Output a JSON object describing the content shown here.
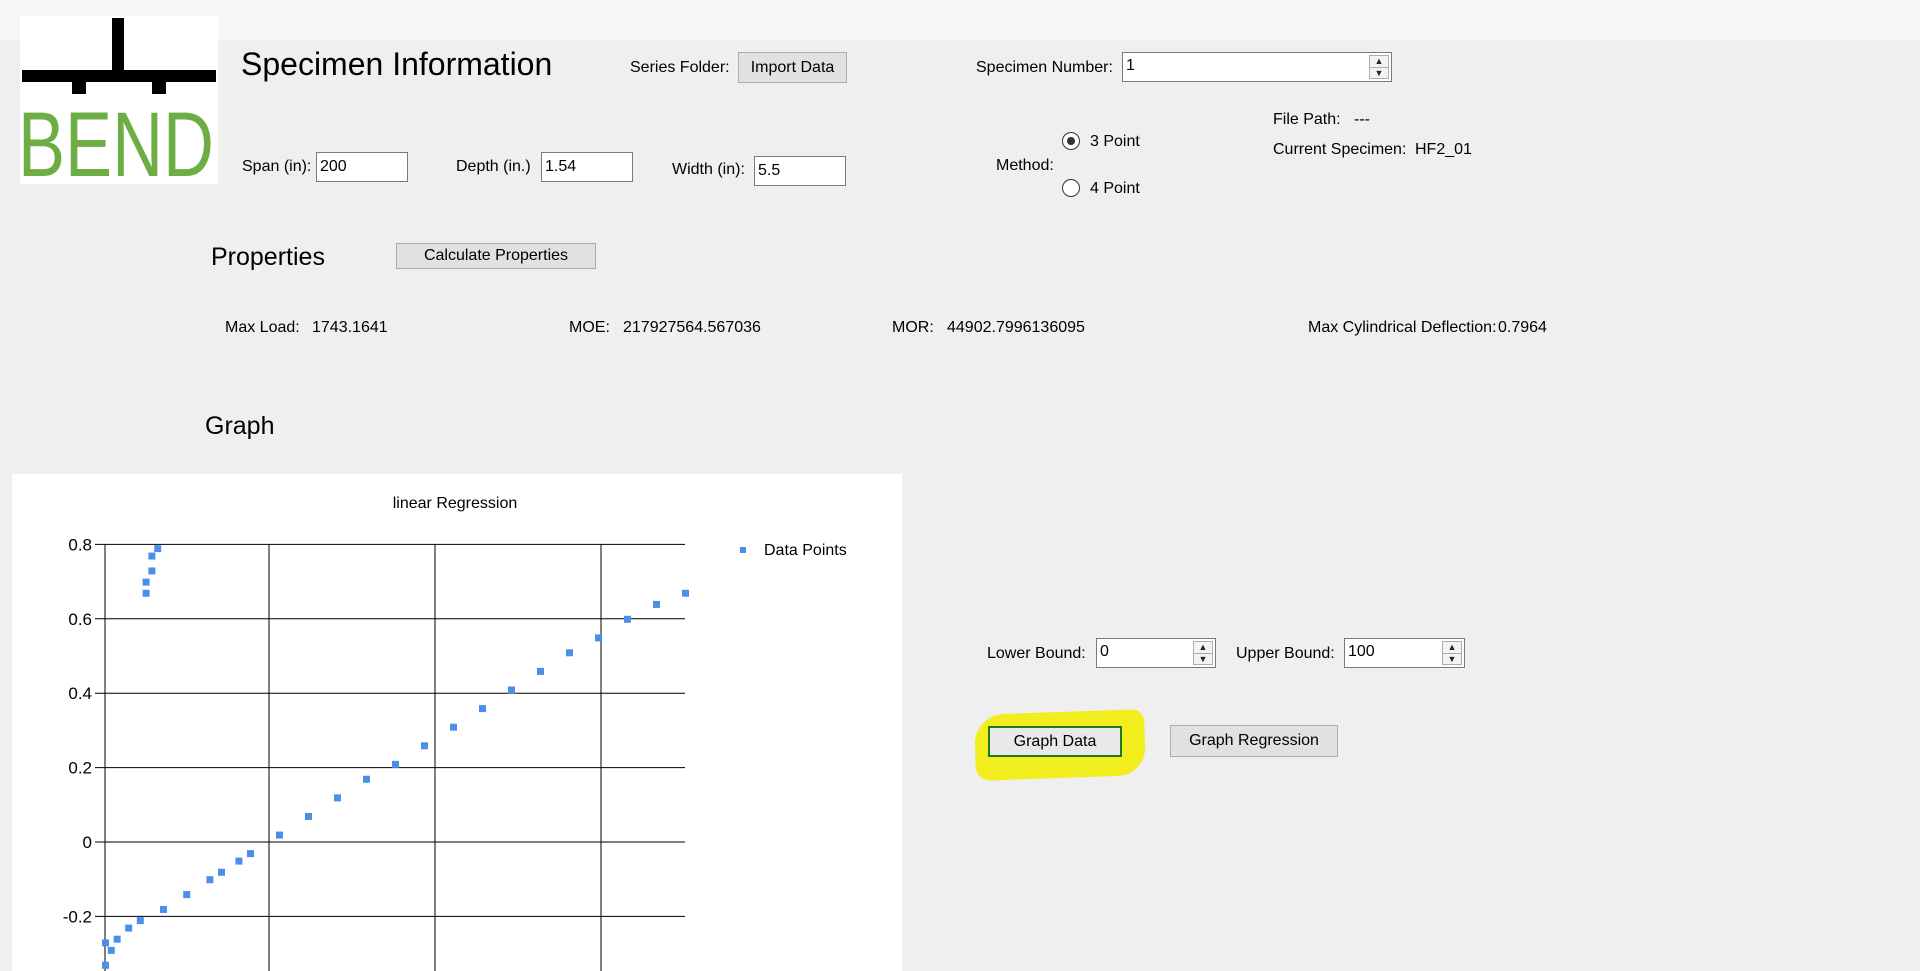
{
  "specimen_info": {
    "title": "Specimen Information",
    "series_folder_label": "Series Folder:",
    "import_button": "Import Data",
    "specimen_number_label": "Specimen Number:",
    "specimen_number_value": "1",
    "span_label": "Span (in):",
    "span_value": "200",
    "depth_label": "Depth (in.)",
    "depth_value": "1.54",
    "width_label": "Width (in):",
    "width_value": "5.5",
    "method_label": "Method:",
    "method_options": [
      "3 Point",
      "4 Point"
    ],
    "method_selected": "3 Point",
    "file_path_label": "File Path:",
    "file_path_value": "---",
    "current_specimen_label": "Current Specimen:",
    "current_specimen_value": "HF2_01",
    "logo_text": "BEND"
  },
  "properties": {
    "title": "Properties",
    "calculate_button": "Calculate Properties",
    "max_load_label": "Max Load:",
    "max_load_value": "1743.1641",
    "moe_label": "MOE:",
    "moe_value": "217927564.567036",
    "mor_label": "MOR:",
    "mor_value": "44902.7996136095",
    "max_defl_label": "Max Cylindrical Deflection:",
    "max_defl_value": "0.7964"
  },
  "graph": {
    "title": "Graph",
    "lower_bound_label": "Lower Bound:",
    "lower_bound_value": "0",
    "upper_bound_label": "Upper Bound:",
    "upper_bound_value": "100",
    "graph_data_button": "Graph Data",
    "graph_regression_button": "Graph Regression"
  },
  "colors": {
    "logo_green": "#6cae44",
    "series_blue": "#4a8fe8",
    "highlight_yellow": "#f2ee1e",
    "focus_green": "#1f7a1f"
  },
  "chart_data": {
    "type": "scatter",
    "title": "linear Regression",
    "xlabel": "",
    "ylabel": "",
    "ylim": [
      -0.35,
      0.8
    ],
    "y_ticks": [
      "0.8",
      "0.6",
      "0.4",
      "0.2",
      "0",
      "-0.2"
    ],
    "grid": true,
    "legend_position": "right",
    "series": [
      {
        "name": "Data Points",
        "x": [
          0.0,
          0.0,
          0.01,
          0.02,
          0.04,
          0.06,
          0.1,
          0.14,
          0.18,
          0.2,
          0.23,
          0.25,
          0.3,
          0.35,
          0.4,
          0.45,
          0.5,
          0.55,
          0.6,
          0.65,
          0.7,
          0.75,
          0.8,
          0.85,
          0.9,
          0.95,
          1.0,
          0.07,
          0.07,
          0.08,
          0.08,
          0.09
        ],
        "y": [
          -0.27,
          -0.33,
          -0.29,
          -0.26,
          -0.23,
          -0.21,
          -0.18,
          -0.14,
          -0.1,
          -0.08,
          -0.05,
          -0.03,
          0.02,
          0.07,
          0.12,
          0.17,
          0.21,
          0.26,
          0.31,
          0.36,
          0.41,
          0.46,
          0.51,
          0.55,
          0.6,
          0.64,
          0.67,
          0.67,
          0.7,
          0.73,
          0.77,
          0.79
        ]
      }
    ]
  }
}
